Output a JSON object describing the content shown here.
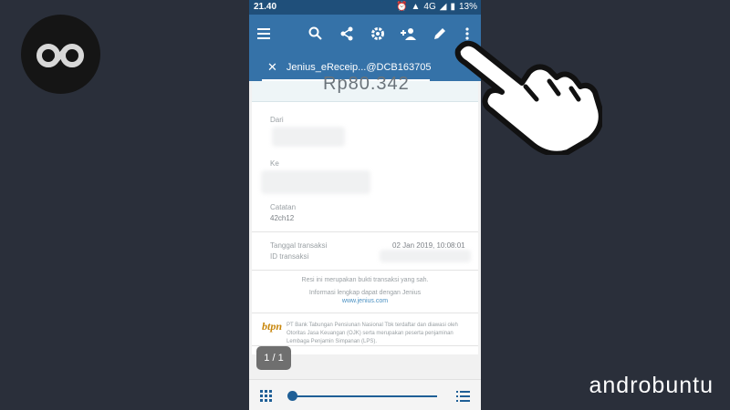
{
  "status": {
    "time": "21.40",
    "network": "4G",
    "battery": "13%"
  },
  "tab": {
    "title": "Jenius_eReceip...@DCB163705"
  },
  "receipt": {
    "amount": "Rp80.342",
    "from_label": "Dari",
    "to_label": "Ke",
    "note_label": "Catatan",
    "note_value": "42ch12",
    "date_label": "Tanggal transaksi",
    "date_value": "02 Jan 2019, 10:08:01",
    "id_label": "ID transaksi",
    "notice_line1": "Resi ini merupakan bukti transaksi yang sah.",
    "notice_line2": "Informasi lengkap dapat dengan Jenius",
    "notice_link": "www.jenius.com",
    "footer_brand": "btpn",
    "footer_text": "PT Bank Tabungan Pensiunan Nasional Tbk terdaftar dan diawasi oleh Otoritas Jasa Keuangan (OJK) serta merupakan peserta penjaminan Lembaga Penjamin Simpanan (LPS)."
  },
  "viewer": {
    "page_indicator": "1 / 1"
  },
  "brand": {
    "name": "androbuntu"
  },
  "colors": {
    "toolbar": "#3572a8",
    "statusbar": "#1f4f7a",
    "accent": "#1f5f96"
  }
}
